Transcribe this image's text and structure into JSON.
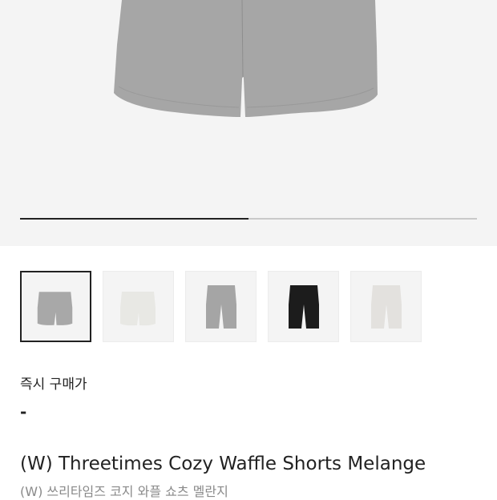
{
  "gallery": {
    "progress_fraction": 0.5,
    "product_color": "#a6a6a6",
    "thumbnails": [
      {
        "name": "gray-shorts",
        "color": "#a8a8a8",
        "selected": true
      },
      {
        "name": "ivory-shorts",
        "color": "#e8e8e4",
        "selected": false
      },
      {
        "name": "gray-long-shorts",
        "color": "#a5a5a5",
        "selected": false
      },
      {
        "name": "black-shorts",
        "color": "#1c1c1c",
        "selected": false
      },
      {
        "name": "light-gray-shorts",
        "color": "#e3e1de",
        "selected": false
      }
    ]
  },
  "price": {
    "label": "즉시 구매가",
    "value": "-"
  },
  "product": {
    "title": "(W) Threetimes Cozy Waffle Shorts Melange",
    "subtitle": "(W) 쓰리타임즈 코지 와플 쇼츠 멜란지"
  }
}
